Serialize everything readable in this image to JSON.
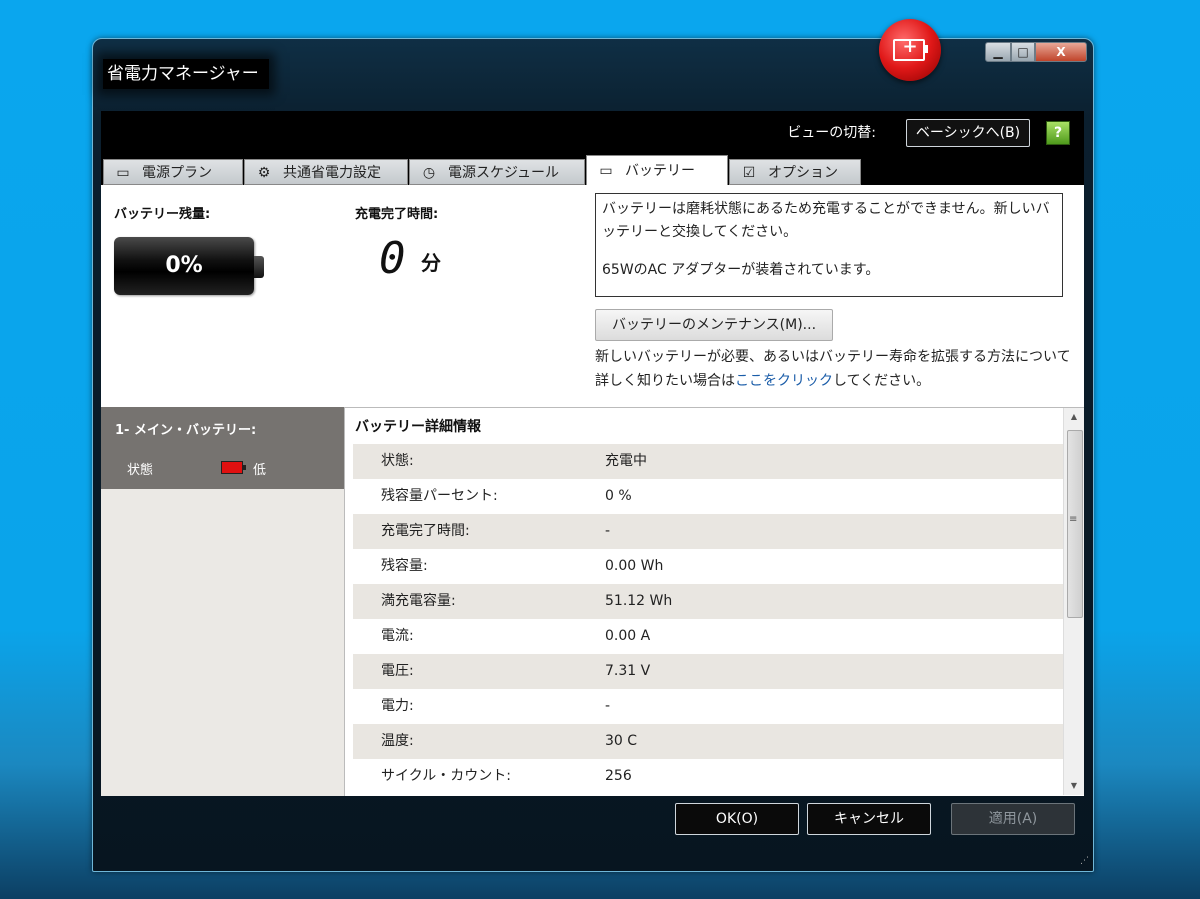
{
  "window": {
    "title": "省電力マネージャー",
    "min": "▁",
    "max": "□",
    "close": "X"
  },
  "toolbar": {
    "view_label": "ビューの切替:",
    "view_button": "ベーシックへ(B)",
    "help": "?"
  },
  "tabs": [
    {
      "label": "電源プラン",
      "icon": "plan-icon"
    },
    {
      "label": "共通省電力設定",
      "icon": "gear-icon"
    },
    {
      "label": "電源スケジュール",
      "icon": "schedule-icon"
    },
    {
      "label": "バッテリー",
      "icon": "battery-icon"
    },
    {
      "label": "オプション",
      "icon": "checkbox-icon"
    }
  ],
  "summary": {
    "remaining_label": "バッテリー残量:",
    "remaining_value": "0%",
    "complete_label": "充電完了時間:",
    "complete_value": "0",
    "complete_unit": "分",
    "message_line1": "バッテリーは磨耗状態にあるため充電することができません。新しいバッテリーと交換してください。",
    "message_line2": "65WのAC アダプターが装着されています。",
    "maintenance_button": "バッテリーのメンテナンス(M)...",
    "info_before": "新しいバッテリーが必要、あるいはバッテリー寿命を拡張する方法について詳しく知りたい場合は",
    "info_link": "ここをクリック",
    "info_after": "してください。"
  },
  "left_panel": {
    "title": "1- メイン・バッテリー:",
    "status_label": "状態",
    "status_value": "低"
  },
  "details": {
    "title": "バッテリー詳細情報",
    "rows": [
      {
        "k": "状態:",
        "v": "充電中"
      },
      {
        "k": "残容量パーセント:",
        "v": "0 %"
      },
      {
        "k": "充電完了時間:",
        "v": "-"
      },
      {
        "k": "残容量:",
        "v": "0.00 Wh"
      },
      {
        "k": "満充電容量:",
        "v": "51.12 Wh"
      },
      {
        "k": "電流:",
        "v": "0.00 A"
      },
      {
        "k": "電圧:",
        "v": "7.31 V"
      },
      {
        "k": "電力:",
        "v": "-"
      },
      {
        "k": "温度:",
        "v": "30 C"
      },
      {
        "k": "サイクル・カウント:",
        "v": "256"
      }
    ]
  },
  "buttons": {
    "ok": "OK(O)",
    "cancel": "キャンセル",
    "apply": "適用(A)"
  },
  "colors": {
    "accent_red": "#e01818",
    "link": "#1a5ca8"
  }
}
